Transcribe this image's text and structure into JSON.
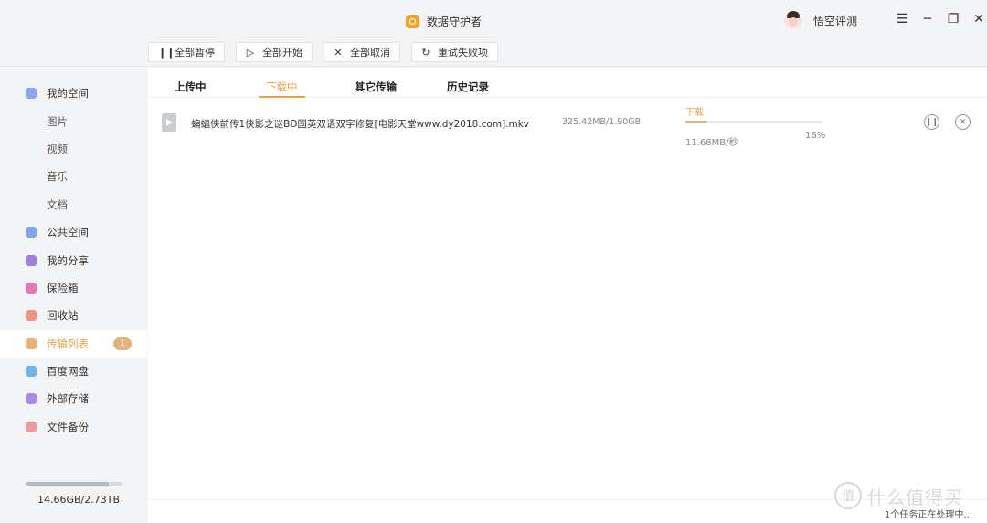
{
  "window": {
    "title": "数据守护者",
    "username": "悟空评测",
    "controls": [
      "☰",
      "─",
      "❐",
      "✕"
    ]
  },
  "toolbar": {
    "pause_all": "全部暂停",
    "start_all": "全部开始",
    "cancel_all": "全部取消",
    "retry_failed": "重试失败项"
  },
  "sidebar": {
    "items": [
      {
        "label": "我的空间",
        "icon": "my-space-icon",
        "color": "#8aa6f0"
      },
      {
        "label": "图片",
        "sub": true
      },
      {
        "label": "视频",
        "sub": true
      },
      {
        "label": "音乐",
        "sub": true
      },
      {
        "label": "文档",
        "sub": true
      },
      {
        "label": "公共空间",
        "icon": "send-icon",
        "color": "#7fa4e8"
      },
      {
        "label": "我的分享",
        "icon": "share-icon",
        "color": "#9f7fe0"
      },
      {
        "label": "保险箱",
        "icon": "safe-icon",
        "color": "#e776b4"
      },
      {
        "label": "回收站",
        "icon": "trash-icon",
        "color": "#f09380"
      },
      {
        "label": "传输列表",
        "icon": "transfer-icon",
        "color": "#e9b574",
        "active": true,
        "badge": "1"
      },
      {
        "label": "百度网盘",
        "icon": "cloud-icon",
        "color": "#6fb4ea"
      },
      {
        "label": "外部存储",
        "icon": "usb-icon",
        "color": "#a98be6"
      },
      {
        "label": "文件备份",
        "icon": "backup-icon",
        "color": "#f19a9a"
      }
    ],
    "storage_text": "14.66GB/2.73TB",
    "storage_fraction": 0.86
  },
  "tabs": [
    {
      "label": "上传中",
      "active": false
    },
    {
      "label": "下载中",
      "active": true
    },
    {
      "label": "其它传输",
      "active": false
    },
    {
      "label": "历史记录",
      "active": false
    }
  ],
  "transfer": {
    "file_name": "蝙蝠侠前传1侠影之谜BD国英双语双字修复[电影天堂www.dy2018.com].mkv",
    "file_icon": "video-file-icon",
    "size": "325.42MB/1.90GB",
    "status": "下载",
    "speed": "11.68MB/秒",
    "percent_text": "16%",
    "progress": 0.16
  },
  "footer": {
    "status": "1个任务正在处理中..."
  },
  "watermark": {
    "text": "什么值得买"
  }
}
